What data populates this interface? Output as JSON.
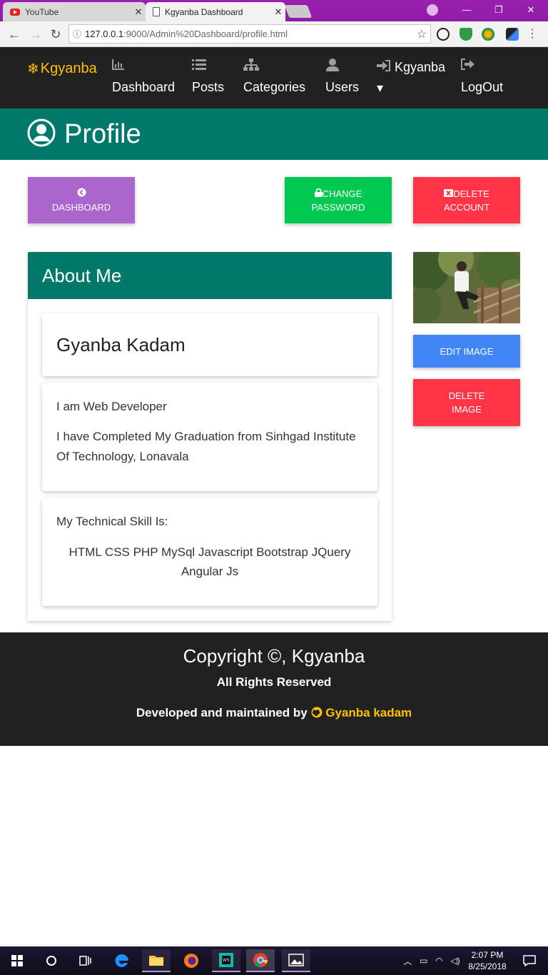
{
  "browser": {
    "tabs": [
      {
        "title": "YouTube",
        "close": "✕"
      },
      {
        "title": "Kgyanba Dashboard",
        "close": "✕"
      }
    ],
    "url_host": "127.0.0.1",
    "url_path": ":9000/Admin%20Dashboard/profile.html",
    "window_controls": [
      "—",
      "❐",
      "✕"
    ]
  },
  "nav": {
    "brand": "Kgyanba",
    "items": [
      {
        "icon": "bar-chart-icon",
        "label": "Dashboard"
      },
      {
        "icon": "list-icon",
        "label": "Posts"
      },
      {
        "icon": "sitemap-icon",
        "label": "Categories"
      },
      {
        "icon": "user-icon",
        "label": "Users"
      },
      {
        "icon": "sign-in-icon",
        "label": "Kgyanba"
      },
      {
        "icon": "sign-out-icon",
        "label": "LogOut"
      }
    ],
    "dropdown_caret": "▾"
  },
  "header": {
    "title": "Profile"
  },
  "actions": {
    "dashboard": "Dashboard",
    "change_password_1": "Change",
    "change_password_2": "Password",
    "delete_account_1": "Delete",
    "delete_account_2": "Account"
  },
  "about": {
    "heading": "About Me",
    "name": "Gyanba Kadam",
    "role": "I am Web Developer",
    "education": "I have Completed My Graduation from Sinhgad Institute Of Technology, Lonavala",
    "skills_label": "My Technical Skill Is:",
    "skills": "HTML CSS PHP MySql Javascript Bootstrap JQuery Angular Js"
  },
  "image_actions": {
    "edit": "Edit Image",
    "delete_1": "Delete",
    "delete_2": "Image"
  },
  "footer": {
    "copyright": "Copyright ©, Kgyanba",
    "rights": "All Rights Reserved",
    "developed_by": "Developed and maintained by",
    "author": "Gyanba kadam"
  },
  "taskbar": {
    "time": "2:07 PM",
    "date": "8/25/2018"
  },
  "colors": {
    "teal": "#00796b",
    "dark": "#212121",
    "brand": "#ffc107",
    "purple": "#aa66cc",
    "green": "#00c851",
    "red": "#ff3547",
    "blue": "#4285f4"
  }
}
